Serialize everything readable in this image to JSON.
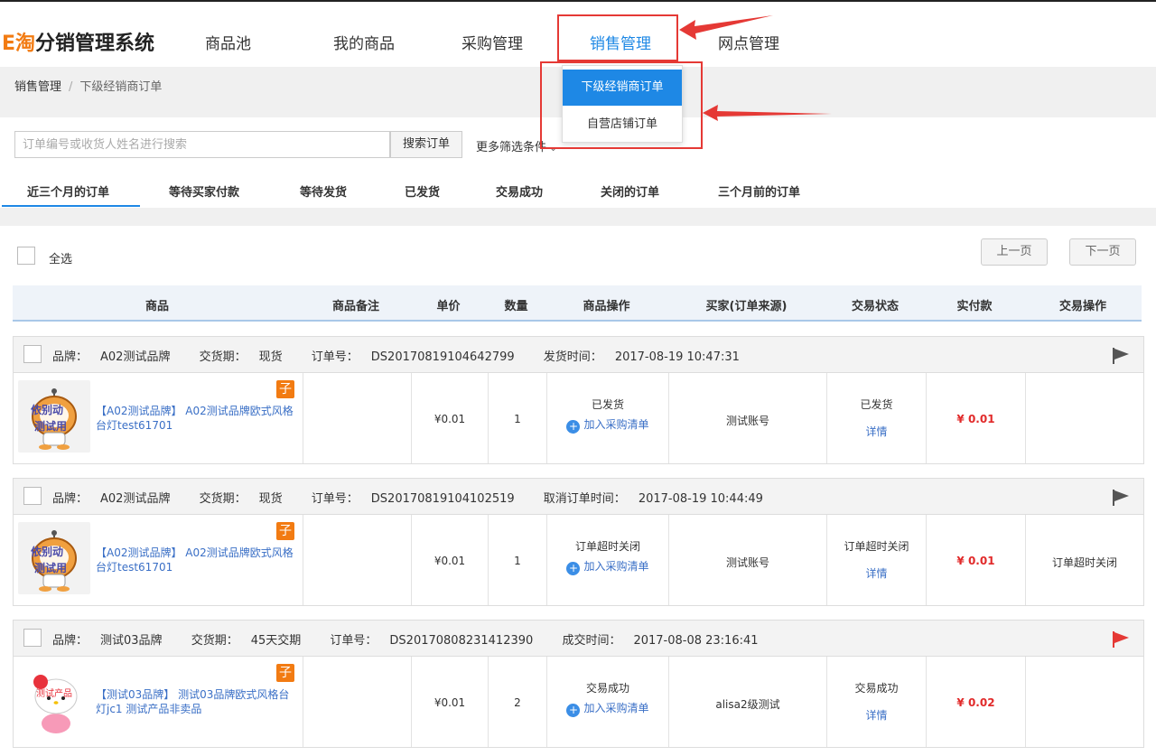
{
  "app": {
    "logo_prefix": "E淘",
    "logo_rest": "分销管理系统"
  },
  "nav": {
    "items": [
      "商品池",
      "我的商品",
      "采购管理",
      "销售管理",
      "网点管理"
    ],
    "active_index": 3
  },
  "dropdown": {
    "items": [
      "下级经销商订单",
      "自营店铺订单"
    ],
    "active_index": 0
  },
  "breadcrumb": {
    "root": "销售管理",
    "separator": "/",
    "current": "下级经销商订单"
  },
  "search": {
    "placeholder": "订单编号或收货人姓名进行搜索",
    "value": "",
    "button_label": "搜索订单",
    "more_filters_label": "更多筛选条件"
  },
  "tabs": {
    "items": [
      "近三个月的订单",
      "等待买家付款",
      "等待发货",
      "已发货",
      "交易成功",
      "关闭的订单",
      "三个月前的订单"
    ],
    "active_index": 0
  },
  "list": {
    "select_all_label": "全选",
    "prev_label": "上一页",
    "next_label": "下一页",
    "columns": [
      "商品",
      "商品备注",
      "单价",
      "数量",
      "商品操作",
      "买家(订单来源)",
      "交易状态",
      "实付款",
      "交易操作"
    ]
  },
  "labels": {
    "brand": "品牌：",
    "delivery": "交货期：",
    "order_no": "订单号：",
    "add_to_purchase": "加入采购清单",
    "detail": "详情",
    "sub_badge": "子"
  },
  "orders": [
    {
      "brand": "A02测试品牌",
      "delivery": "现货",
      "order_no": "DS20170819104642799",
      "time_label": "发货时间：",
      "time": "2017-08-19 10:47:31",
      "product_title": "【A02测试品牌】 A02测试品牌欧式风格台灯test61701",
      "remark": "",
      "price": "¥0.01",
      "quantity": "1",
      "product_status": "已发货",
      "buyer": "测试账号",
      "trade_status": "已发货",
      "paid": "¥ 0.01",
      "trade_action": "",
      "flag_color": "#555555",
      "thumb": "astronaut"
    },
    {
      "brand": "A02测试品牌",
      "delivery": "现货",
      "order_no": "DS20170819104102519",
      "time_label": "取消订单时间：",
      "time": "2017-08-19 10:44:49",
      "product_title": "【A02测试品牌】 A02测试品牌欧式风格台灯test61701",
      "remark": "",
      "price": "¥0.01",
      "quantity": "1",
      "product_status": "订单超时关闭",
      "buyer": "测试账号",
      "trade_status": "订单超时关闭",
      "paid": "¥ 0.01",
      "trade_action": "订单超时关闭",
      "flag_color": "#555555",
      "thumb": "astronaut"
    },
    {
      "brand": "测试03品牌",
      "delivery": "45天交期",
      "order_no": "DS20170808231412390",
      "time_label": "成交时间：",
      "time": "2017-08-08 23:16:41",
      "product_title": "【测试03品牌】 测试03品牌欧式风格台灯jc1 测试产品非卖品",
      "remark": "",
      "price": "¥0.01",
      "quantity": "2",
      "product_status": "交易成功",
      "buyer": "alisa2级测试",
      "trade_status": "交易成功",
      "paid": "¥ 0.02",
      "trade_action": "",
      "flag_color": "#e53935",
      "thumb": "kitty"
    }
  ],
  "thumb_text": {
    "astronaut": [
      "依别动",
      "测试用"
    ],
    "kitty": [
      "测试产品"
    ]
  },
  "colors": {
    "accent": "#1e88e5",
    "logo_orange": "#f27b12",
    "price_red": "#e12a2a",
    "annotation_red": "#e53935",
    "link_blue": "#3a6fc6"
  }
}
